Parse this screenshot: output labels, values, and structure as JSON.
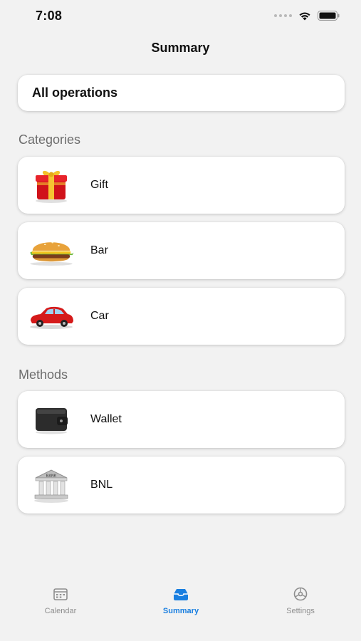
{
  "status_bar": {
    "time": "7:08"
  },
  "nav": {
    "title": "Summary"
  },
  "all_operations": {
    "label": "All operations"
  },
  "categories": {
    "header": "Categories",
    "items": [
      {
        "label": "Gift",
        "icon": "gift-icon"
      },
      {
        "label": "Bar",
        "icon": "burger-icon"
      },
      {
        "label": "Car",
        "icon": "car-icon"
      }
    ]
  },
  "methods": {
    "header": "Methods",
    "items": [
      {
        "label": "Wallet",
        "icon": "wallet-icon"
      },
      {
        "label": "BNL",
        "icon": "bank-icon"
      }
    ]
  },
  "bank_sign": "BANK",
  "tabs": [
    {
      "label": "Calendar",
      "icon": "calendar-icon",
      "active": false
    },
    {
      "label": "Summary",
      "icon": "tray-icon",
      "active": true
    },
    {
      "label": "Settings",
      "icon": "settings-icon",
      "active": false
    }
  ],
  "colors": {
    "accent": "#1a7fe0",
    "background": "#f2f2f2",
    "card": "#ffffff",
    "section_header": "#6d6d6d"
  }
}
